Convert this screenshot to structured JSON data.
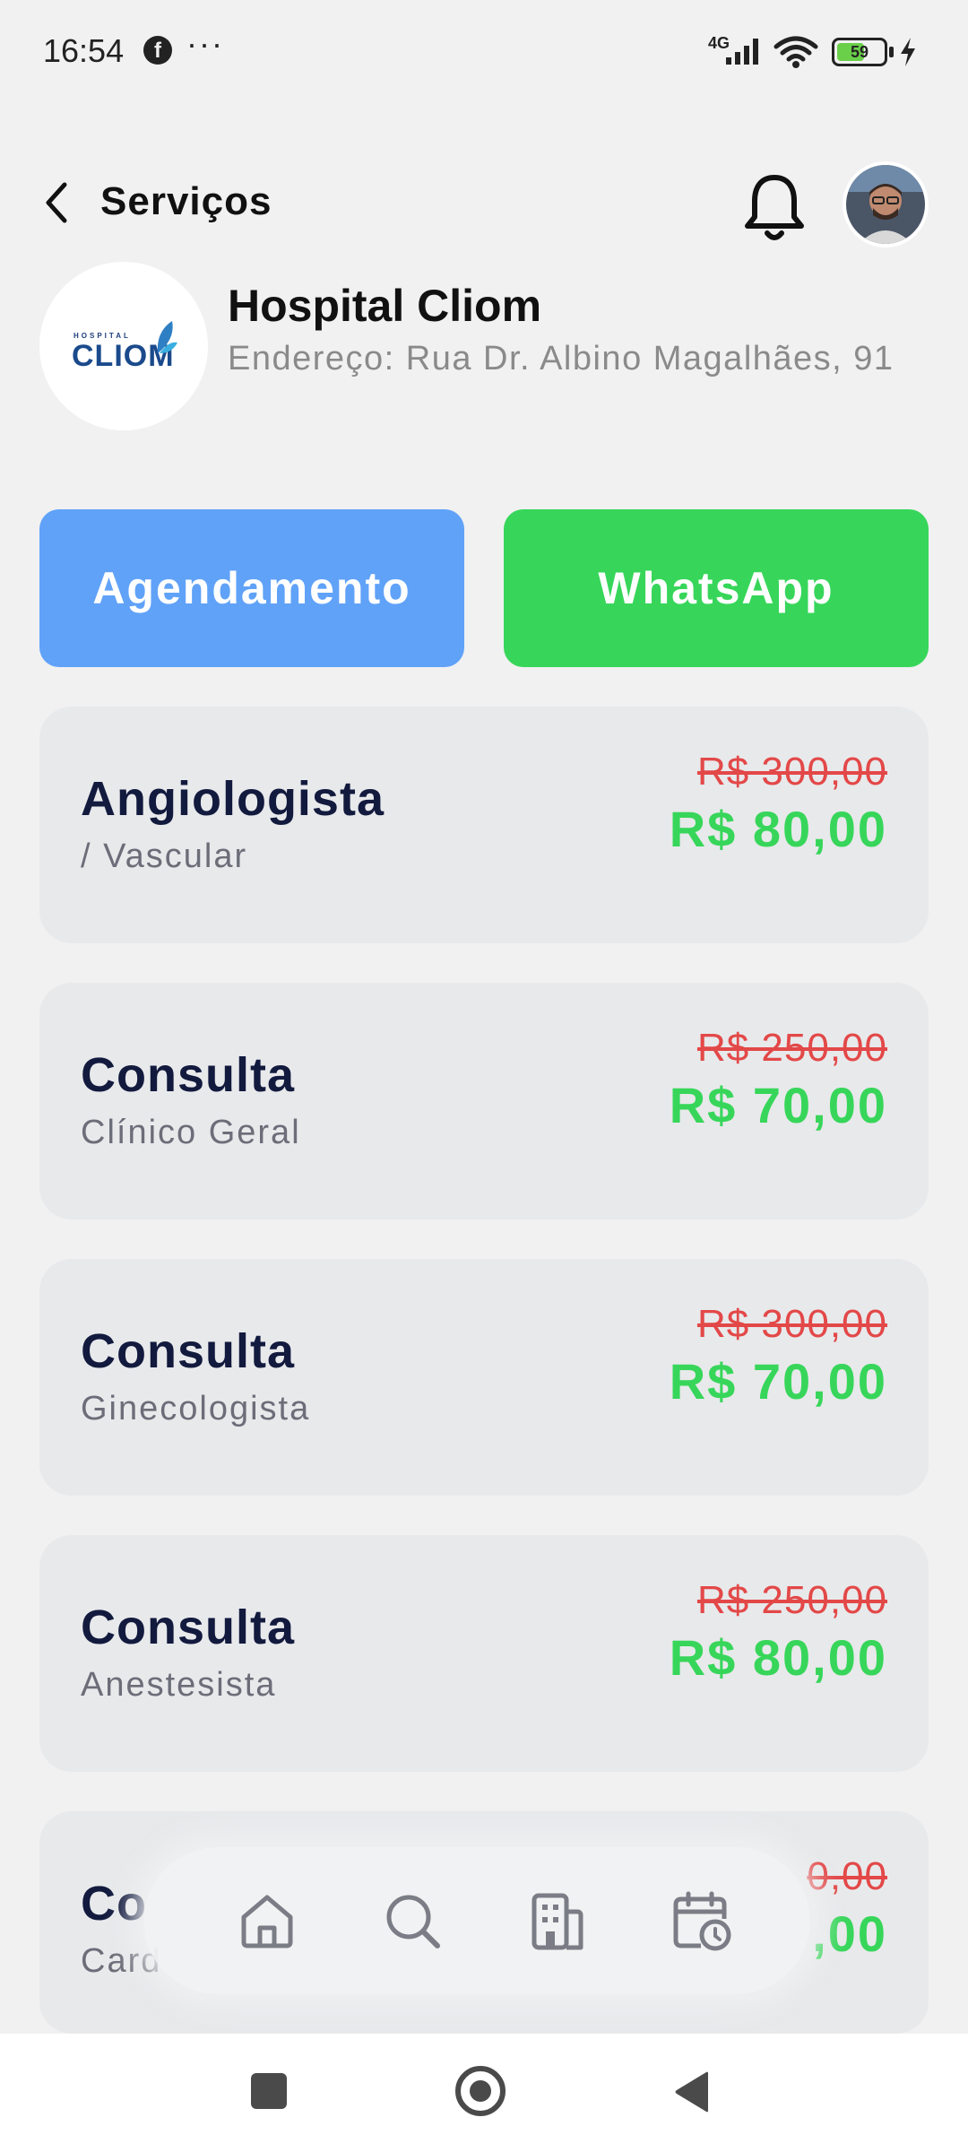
{
  "status_bar": {
    "time": "16:54",
    "network": "4G",
    "battery": "59",
    "battery_level": 0.59
  },
  "header": {
    "title": "Serviços"
  },
  "hospital": {
    "name": "Hospital Cliom",
    "address": "Endereço: Rua Dr. Albino Magalhães, 91",
    "logo_small": "HOSPITAL",
    "logo_text": "CLIOM"
  },
  "actions": {
    "agendamento": "Agendamento",
    "whatsapp": "WhatsApp"
  },
  "services": [
    {
      "title": "Angiologista",
      "subtitle": "/ Vascular",
      "old_price": "R$ 300,00",
      "new_price": "R$ 80,00"
    },
    {
      "title": "Consulta",
      "subtitle": "Clínico Geral",
      "old_price": "R$ 250,00",
      "new_price": "R$ 70,00"
    },
    {
      "title": "Consulta",
      "subtitle": "Ginecologista",
      "old_price": "R$ 300,00",
      "new_price": "R$ 70,00"
    },
    {
      "title": "Consulta",
      "subtitle": "Anestesista",
      "old_price": "R$ 250,00",
      "new_price": "R$ 80,00"
    },
    {
      "title": "Co",
      "subtitle": "Card",
      "old_price": "0,00",
      "new_price": ",00"
    }
  ],
  "bottom_nav": {
    "items": [
      "home-icon",
      "search-icon",
      "building-icon",
      "calendar-clock-icon"
    ]
  },
  "colors": {
    "agendamento": "#60a2f8",
    "whatsapp": "#37d65a",
    "old_price": "#e34848",
    "new_price": "#37d65a",
    "title": "#121a3e"
  }
}
